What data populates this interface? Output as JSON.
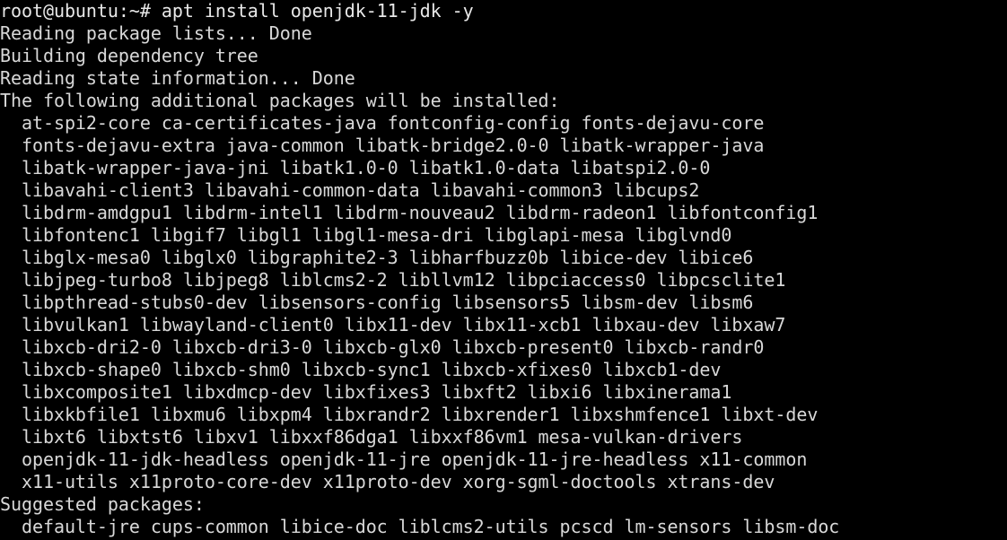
{
  "terminal": {
    "app": "terminal",
    "background_color": "#000000",
    "foreground_color": "#d8d8d8",
    "columns": 80,
    "rows": 24,
    "prompt": "root@ubuntu:~#",
    "command": "apt install openjdk-11-jdk -y",
    "lines": [
      "root@ubuntu:~# apt install openjdk-11-jdk -y",
      "Reading package lists... Done",
      "Building dependency tree",
      "Reading state information... Done",
      "The following additional packages will be installed:",
      "  at-spi2-core ca-certificates-java fontconfig-config fonts-dejavu-core",
      "  fonts-dejavu-extra java-common libatk-bridge2.0-0 libatk-wrapper-java",
      "  libatk-wrapper-java-jni libatk1.0-0 libatk1.0-data libatspi2.0-0",
      "  libavahi-client3 libavahi-common-data libavahi-common3 libcups2",
      "  libdrm-amdgpu1 libdrm-intel1 libdrm-nouveau2 libdrm-radeon1 libfontconfig1",
      "  libfontenc1 libgif7 libgl1 libgl1-mesa-dri libglapi-mesa libglvnd0",
      "  libglx-mesa0 libglx0 libgraphite2-3 libharfbuzz0b libice-dev libice6",
      "  libjpeg-turbo8 libjpeg8 liblcms2-2 libllvm12 libpciaccess0 libpcsclite1",
      "  libpthread-stubs0-dev libsensors-config libsensors5 libsm-dev libsm6",
      "  libvulkan1 libwayland-client0 libx11-dev libx11-xcb1 libxau-dev libxaw7",
      "  libxcb-dri2-0 libxcb-dri3-0 libxcb-glx0 libxcb-present0 libxcb-randr0",
      "  libxcb-shape0 libxcb-shm0 libxcb-sync1 libxcb-xfixes0 libxcb1-dev",
      "  libxcomposite1 libxdmcp-dev libxfixes3 libxft2 libxi6 libxinerama1",
      "  libxkbfile1 libxmu6 libxpm4 libxrandr2 libxrender1 libxshmfence1 libxt-dev",
      "  libxt6 libxtst6 libxv1 libxxf86dga1 libxxf86vm1 mesa-vulkan-drivers",
      "  openjdk-11-jdk-headless openjdk-11-jre openjdk-11-jre-headless x11-common",
      "  x11-utils x11proto-core-dev x11proto-dev xorg-sgml-doctools xtrans-dev",
      "Suggested packages:",
      "  default-jre cups-common libice-doc liblcms2-utils pcscd lm-sensors libsm-doc"
    ]
  }
}
